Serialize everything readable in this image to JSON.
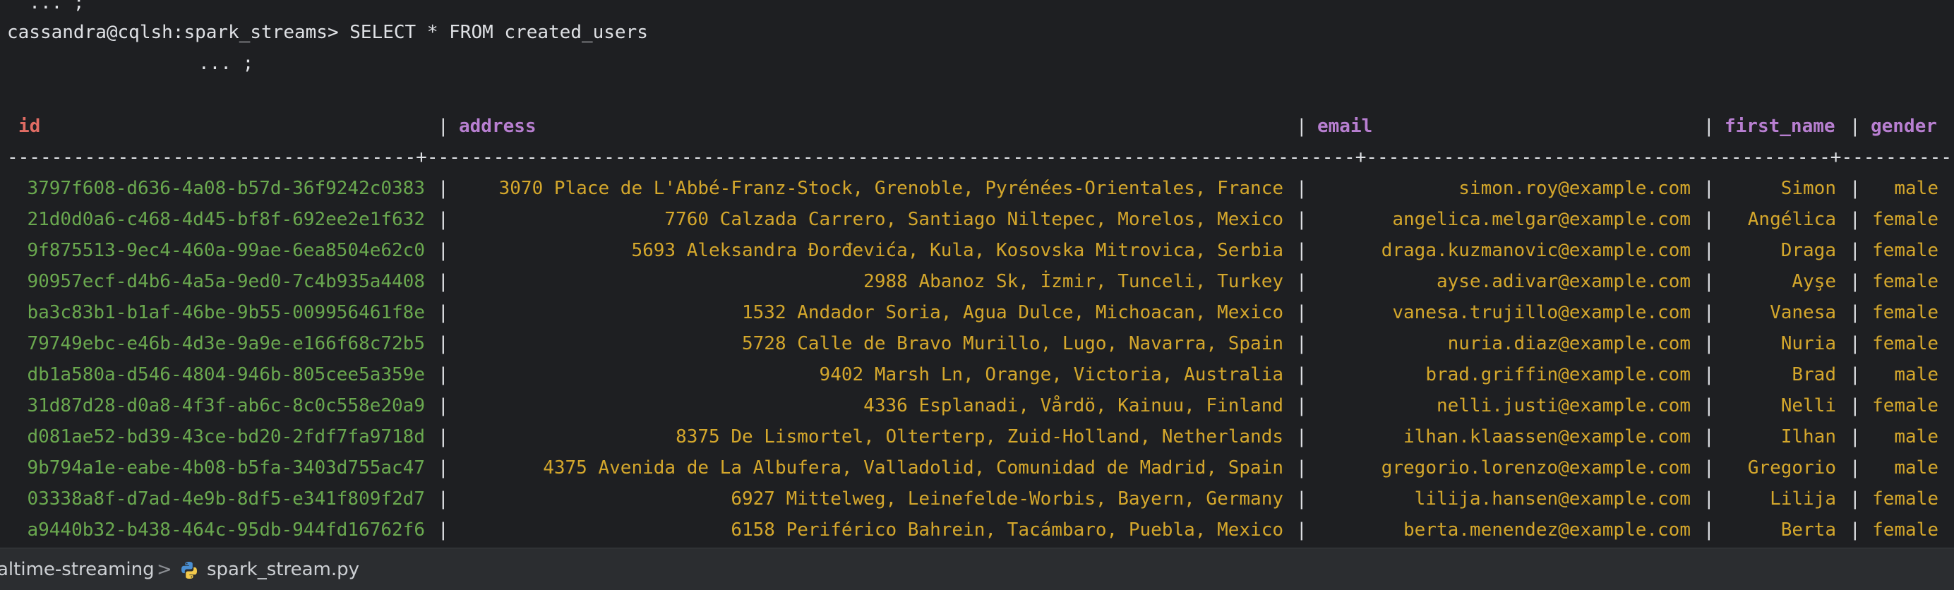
{
  "terminal": {
    "continuation_top": "  ... ;",
    "prompt": "cassandra@cqlsh:spark_streams> SELECT * FROM created_users",
    "continuation": "... ;",
    "columns": [
      "id",
      "address",
      "email",
      "first_name",
      "gender"
    ],
    "separator": "-------------------------------------+------------------------------------------------------------------------------------+------------------------------------------+------------+---------",
    "rows": [
      {
        "id": "3797f608-d636-4a08-b57d-36f9242c0383",
        "address": "3070 Place de L'Abbé-Franz-Stock, Grenoble, Pyrénées-Orientales, France",
        "email": "simon.roy@example.com",
        "first_name": "Simon",
        "gender": "male"
      },
      {
        "id": "21d0d0a6-c468-4d45-bf8f-692ee2e1f632",
        "address": "7760 Calzada Carrero, Santiago Niltepec, Morelos, Mexico",
        "email": "angelica.melgar@example.com",
        "first_name": "Angélica",
        "gender": "female"
      },
      {
        "id": "9f875513-9ec4-460a-99ae-6ea8504e62c0",
        "address": "5693 Aleksandra Đorđevića, Kula, Kosovska Mitrovica, Serbia",
        "email": "draga.kuzmanovic@example.com",
        "first_name": "Draga",
        "gender": "female"
      },
      {
        "id": "90957ecf-d4b6-4a5a-9ed0-7c4b935a4408",
        "address": "2988 Abanoz Sk, İzmir, Tunceli, Turkey",
        "email": "ayse.adivar@example.com",
        "first_name": "Ayşe",
        "gender": "female"
      },
      {
        "id": "ba3c83b1-b1af-46be-9b55-009956461f8e",
        "address": "1532 Andador Soria, Agua Dulce, Michoacan, Mexico",
        "email": "vanesa.trujillo@example.com",
        "first_name": "Vanesa",
        "gender": "female"
      },
      {
        "id": "79749ebc-e46b-4d3e-9a9e-e166f68c72b5",
        "address": "5728 Calle de Bravo Murillo, Lugo, Navarra, Spain",
        "email": "nuria.diaz@example.com",
        "first_name": "Nuria",
        "gender": "female"
      },
      {
        "id": "db1a580a-d546-4804-946b-805cee5a359e",
        "address": "9402 Marsh Ln, Orange, Victoria, Australia",
        "email": "brad.griffin@example.com",
        "first_name": "Brad",
        "gender": "male"
      },
      {
        "id": "31d87d28-d0a8-4f3f-ab6c-8c0c558e20a9",
        "address": "4336 Esplanadi, Vårdö, Kainuu, Finland",
        "email": "nelli.justi@example.com",
        "first_name": "Nelli",
        "gender": "female"
      },
      {
        "id": "d081ae52-bd39-43ce-bd20-2fdf7fa9718d",
        "address": "8375 De Lismortel, Olterterp, Zuid-Holland, Netherlands",
        "email": "ilhan.klaassen@example.com",
        "first_name": "Ilhan",
        "gender": "male"
      },
      {
        "id": "9b794a1e-eabe-4b08-b5fa-3403d755ac47",
        "address": "4375 Avenida de La Albufera, Valladolid, Comunidad de Madrid, Spain",
        "email": "gregorio.lorenzo@example.com",
        "first_name": "Gregorio",
        "gender": "male"
      },
      {
        "id": "03338a8f-d7ad-4e9b-8df5-e341f809f2d7",
        "address": "6927 Mittelweg, Leinefelde-Worbis, Bayern, Germany",
        "email": "lilija.hansen@example.com",
        "first_name": "Lilija",
        "gender": "female"
      },
      {
        "id": "a9440b32-b438-464c-95db-944fd16762f6",
        "address": "6158 Periférico Bahrein, Tacámbaro, Puebla, Mexico",
        "email": "berta.menendez@example.com",
        "first_name": "Berta",
        "gender": "female"
      }
    ]
  },
  "statusbar": {
    "project": "altime-streaming",
    "file": "spark_stream.py",
    "separator_glyph": ">",
    "file_icon": "python-icon"
  }
}
